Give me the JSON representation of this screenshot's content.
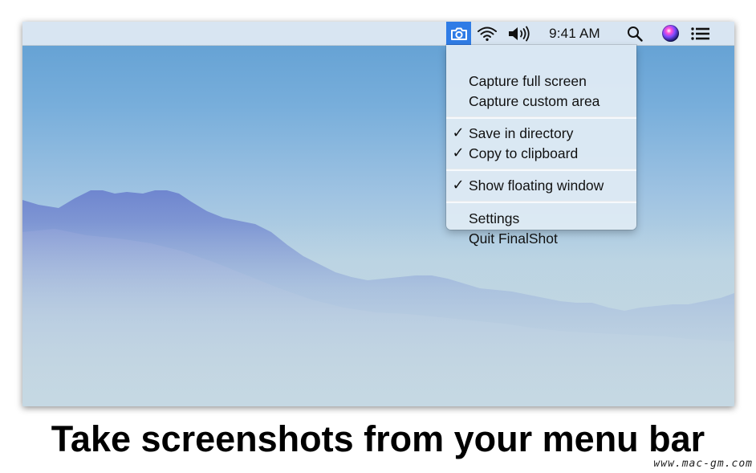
{
  "menubar": {
    "status_icons": [
      "camera-icon",
      "wifi-icon",
      "volume-icon"
    ],
    "clock": "9:41 AM",
    "right_icons": [
      "search-icon",
      "siri-icon",
      "notification-center-icon"
    ],
    "active_item_color": "#2f7ce6"
  },
  "menu": {
    "items": [
      {
        "label": "Capture full screen",
        "checked": false
      },
      {
        "label": "Capture custom area",
        "checked": false
      },
      {
        "label": "Save in directory",
        "checked": true
      },
      {
        "label": "Copy to clipboard",
        "checked": true
      },
      {
        "label": "Show floating window",
        "checked": true
      },
      {
        "label": "Settings",
        "checked": false
      },
      {
        "label": "Quit FinalShot",
        "checked": false
      }
    ],
    "check_glyph": "✓"
  },
  "caption": "Take screenshots from your menu bar",
  "watermark": "www.mac-gm.com"
}
